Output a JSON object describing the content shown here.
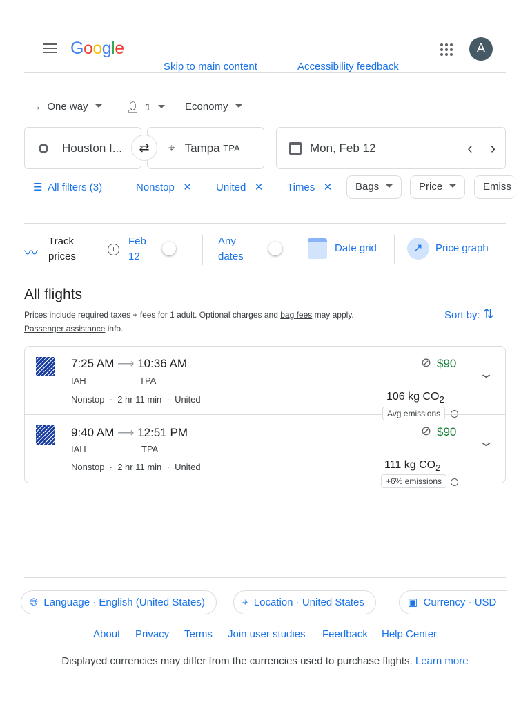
{
  "header": {
    "logo": "Google",
    "skip": "Skip to main content",
    "accessibility": "Accessibility feedback",
    "avatar": "A"
  },
  "search": {
    "trip_type": "One way",
    "passengers": "1",
    "cabin": "Economy",
    "origin": "Houston I...",
    "destination": "Tampa",
    "destination_code": "TPA",
    "date": "Mon, Feb 12"
  },
  "filters": {
    "all": "All filters (3)",
    "chips": [
      "Nonstop",
      "United",
      "Times"
    ],
    "dropdowns": [
      "Bags",
      "Price",
      "Emiss"
    ]
  },
  "tools": {
    "track_1": "Track",
    "track_2": "prices",
    "date_1": "Feb",
    "date_2": "12",
    "any_1": "Any",
    "any_2": "dates",
    "date_grid": "Date grid",
    "price_graph": "Price graph"
  },
  "results": {
    "title": "All flights",
    "note": "Prices include required taxes + fees for 1 adult. Optional charges and ",
    "bag_fees": "bag fees",
    "note2": " may apply.",
    "assistance": "Passenger assistance",
    "info": " info.",
    "sort": "Sort by:",
    "flights": [
      {
        "depart": "7:25 AM",
        "arrive": "10:36 AM",
        "from": "IAH",
        "to": "TPA",
        "stops": "Nonstop",
        "duration": "2 hr 11 min",
        "airline": "United",
        "price": "$90",
        "emissions": "106 kg CO",
        "emissions_label": "Avg emissions"
      },
      {
        "depart": "9:40 AM",
        "arrive": "12:51 PM",
        "from": "IAH",
        "to": "TPA",
        "stops": "Nonstop",
        "duration": "2 hr 11 min",
        "airline": "United",
        "price": "$90",
        "emissions": "111 kg CO",
        "emissions_label": "+6% emissions"
      }
    ]
  },
  "footer": {
    "language": "Language · English (United States)",
    "location": "Location · United States",
    "currency": "Currency · USD",
    "links": [
      "About",
      "Privacy",
      "Terms",
      "Join user studies",
      "Feedback",
      "Help Center"
    ],
    "disclaimer": "Displayed currencies may differ from the currencies used to purchase flights.",
    "learn_more": "Learn more"
  }
}
